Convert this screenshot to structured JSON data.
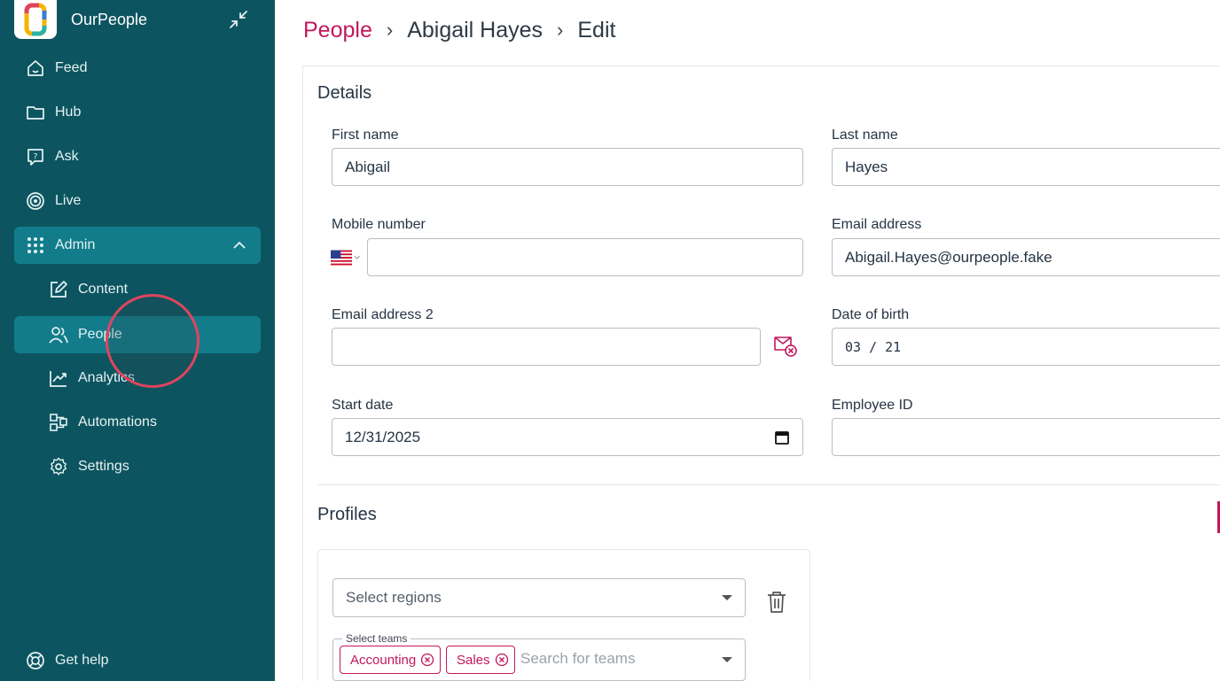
{
  "app": {
    "name": "OurPeople"
  },
  "sidebar": {
    "items": [
      {
        "label": "Feed",
        "icon": "home-icon"
      },
      {
        "label": "Hub",
        "icon": "folder-icon"
      },
      {
        "label": "Ask",
        "icon": "question-bubble-icon"
      },
      {
        "label": "Live",
        "icon": "broadcast-icon"
      },
      {
        "label": "Admin",
        "icon": "grid-dots-icon",
        "expanded": true
      },
      {
        "label": "Content",
        "icon": "edit-icon"
      },
      {
        "label": "People",
        "icon": "users-icon",
        "active": true
      },
      {
        "label": "Analytics",
        "icon": "chart-line-icon"
      },
      {
        "label": "Automations",
        "icon": "automation-icon"
      },
      {
        "label": "Settings",
        "icon": "gear-icon"
      }
    ],
    "help_label": "Get help"
  },
  "breadcrumb": {
    "root": "People",
    "person": "Abigail Hayes",
    "current": "Edit",
    "separator": "›"
  },
  "details": {
    "title": "Details",
    "first_name": {
      "label": "First name",
      "value": "Abigail"
    },
    "last_name": {
      "label": "Last name",
      "value": "Hayes"
    },
    "mobile": {
      "label": "Mobile number",
      "value": "",
      "country": "US"
    },
    "email": {
      "label": "Email address",
      "value": "Abigail.Hayes@ourpeople.fake"
    },
    "email2": {
      "label": "Email address 2",
      "value": ""
    },
    "dob": {
      "label": "Date of birth",
      "value": "03 / 21"
    },
    "start_date": {
      "label": "Start date",
      "value": "12/31/2025"
    },
    "employee_id": {
      "label": "Employee ID",
      "value": ""
    }
  },
  "profiles": {
    "title": "Profiles",
    "regions_placeholder": "Select regions",
    "teams_label": "Select teams",
    "teams_selected": [
      "Accounting",
      "Sales"
    ],
    "teams_placeholder": "Search for teams"
  },
  "colors": {
    "sidebar": "#0c5560",
    "active": "#127c8b",
    "accent": "#c2185b"
  }
}
